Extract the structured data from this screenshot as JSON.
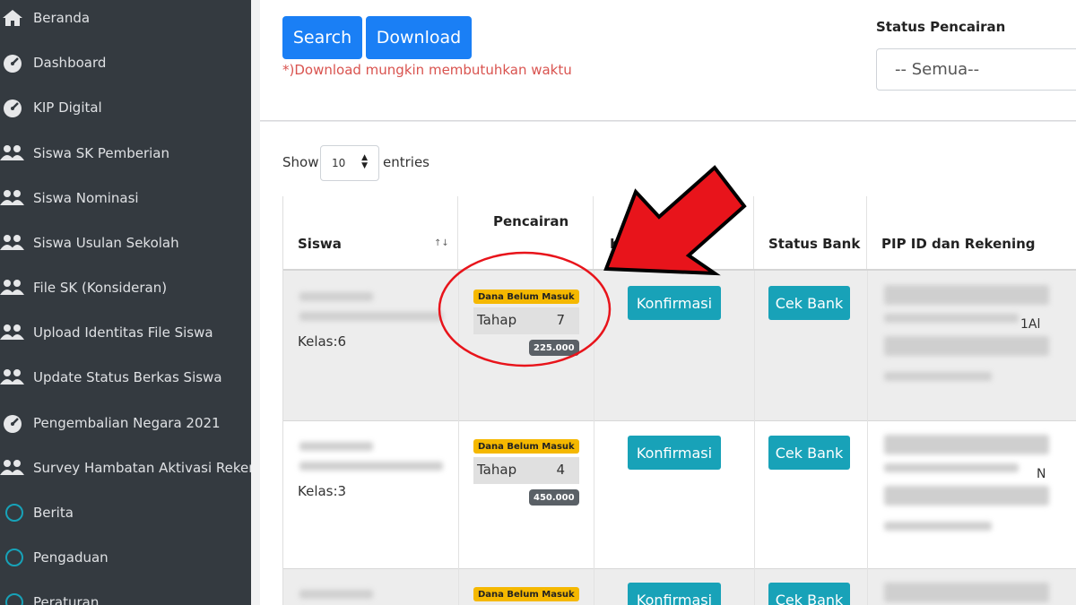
{
  "sidebar": {
    "items": [
      {
        "label": "Beranda",
        "icon": "home-icon"
      },
      {
        "label": "Dashboard",
        "icon": "speedometer-icon"
      },
      {
        "label": "KIP Digital",
        "icon": "speedometer-icon"
      },
      {
        "label": "Siswa SK Pemberian",
        "icon": "users-icon"
      },
      {
        "label": "Siswa Nominasi",
        "icon": "users-icon"
      },
      {
        "label": "Siswa Usulan Sekolah",
        "icon": "users-icon"
      },
      {
        "label": "File SK (Konsideran)",
        "icon": "users-icon"
      },
      {
        "label": "Upload Identitas File Siswa",
        "icon": "users-icon"
      },
      {
        "label": "Update Status Berkas Siswa",
        "icon": "users-icon"
      },
      {
        "label": "Pengembalian Negara 2021",
        "icon": "speedometer-icon"
      },
      {
        "label": "Survey Hambatan Aktivasi Rekeni",
        "icon": "users-icon"
      },
      {
        "label": "Berita",
        "icon": "circle-icon"
      },
      {
        "label": "Pengaduan",
        "icon": "circle-icon"
      },
      {
        "label": "Peraturan",
        "icon": "circle-icon"
      }
    ]
  },
  "toolbar": {
    "search_label": "Search",
    "download_label": "Download",
    "note": "*)Download mungkin membutuhkan waktu"
  },
  "filter": {
    "status_label": "Status Pencairan",
    "status_value": "-- Semua--"
  },
  "table_controls": {
    "show_label": "Show",
    "page_length": "10",
    "entries_label": "entries"
  },
  "table": {
    "headers": {
      "siswa": "Siswa",
      "pencairan": "Pencairan",
      "konfirmasi": "Konfirmasi Sekolah",
      "status_bank": "Status Bank",
      "pip": "PIP ID dan Rekening"
    },
    "rows": [
      {
        "kelas": "Kelas:6",
        "badge": "Dana Belum Masuk",
        "tahap_label": "Tahap",
        "tahap": "7",
        "amount": "225.000",
        "confirm_label": "Konfirmasi",
        "bank_label": "Cek Bank",
        "pip_tail": "1Al"
      },
      {
        "kelas": "Kelas:3",
        "badge": "Dana Belum Masuk",
        "tahap_label": "Tahap",
        "tahap": "4",
        "amount": "450.000",
        "confirm_label": "Konfirmasi",
        "bank_label": "Cek Bank",
        "pip_tail": "N"
      },
      {
        "kelas": "",
        "badge": "Dana Belum Masuk",
        "tahap_label": "",
        "tahap": "",
        "amount": "",
        "confirm_label": "Konfirmasi",
        "bank_label": "Cek Bank",
        "pip_tail": ""
      }
    ]
  },
  "colors": {
    "sidebar_bg": "#343a40",
    "primary": "#1a7ff5",
    "info": "#18a2b8",
    "warning": "#f5b800",
    "annotation_red": "#e8141b"
  }
}
